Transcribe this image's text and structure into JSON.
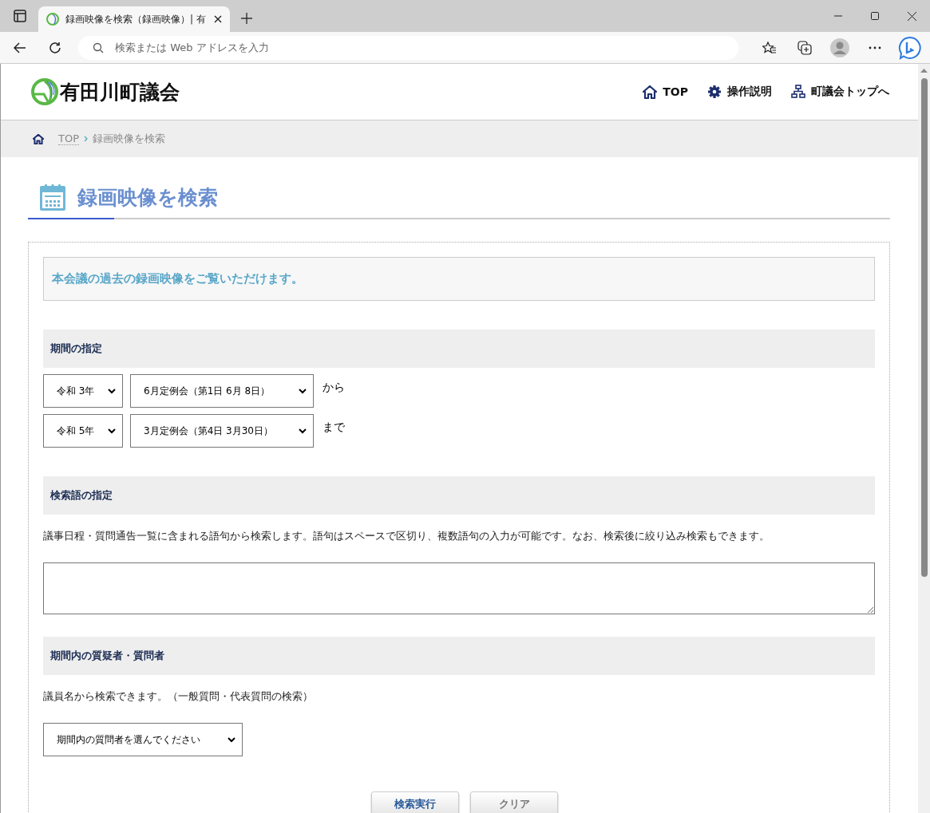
{
  "browser": {
    "tab_title": "録画映像を検索（録画映像）| 有",
    "address_placeholder": "検索または Web アドレスを入力"
  },
  "site": {
    "name": "有田川町議会",
    "nav": [
      {
        "kind": "home",
        "label": "TOP"
      },
      {
        "kind": "gear",
        "label": "操作説明"
      },
      {
        "kind": "sitemap",
        "label": "町議会トップへ"
      }
    ]
  },
  "breadcrumb": [
    {
      "label": "TOP"
    },
    {
      "label": "録画映像を検索"
    }
  ],
  "page_title": "録画映像を検索",
  "intro": "本会議の過去の録画映像をご覧いただけます。",
  "period": {
    "heading": "期間の指定",
    "rows": [
      {
        "year": "令和 3年",
        "meeting": "6月定例会（第1日 6月 8日）",
        "suffix": "から"
      },
      {
        "year": "令和 5年",
        "meeting": "3月定例会（第4日 3月30日）",
        "suffix": "まで"
      }
    ]
  },
  "keywords": {
    "heading": "検索語の指定",
    "description": "議事日程・質問通告一覧に含まれる語句から検索します。語句はスペースで区切り、複数語句の入力が可能です。なお、検索後に絞り込み検索もできます。"
  },
  "questioner": {
    "heading": "期間内の質疑者・質問者",
    "description": "議員名から検索できます。（一般質問・代表質問の検索）",
    "select": "期間内の質問者を選んでください"
  },
  "buttons": [
    {
      "kind": "primary",
      "label": "検索実行"
    },
    {
      "kind": "secondary",
      "label": "クリア"
    }
  ]
}
